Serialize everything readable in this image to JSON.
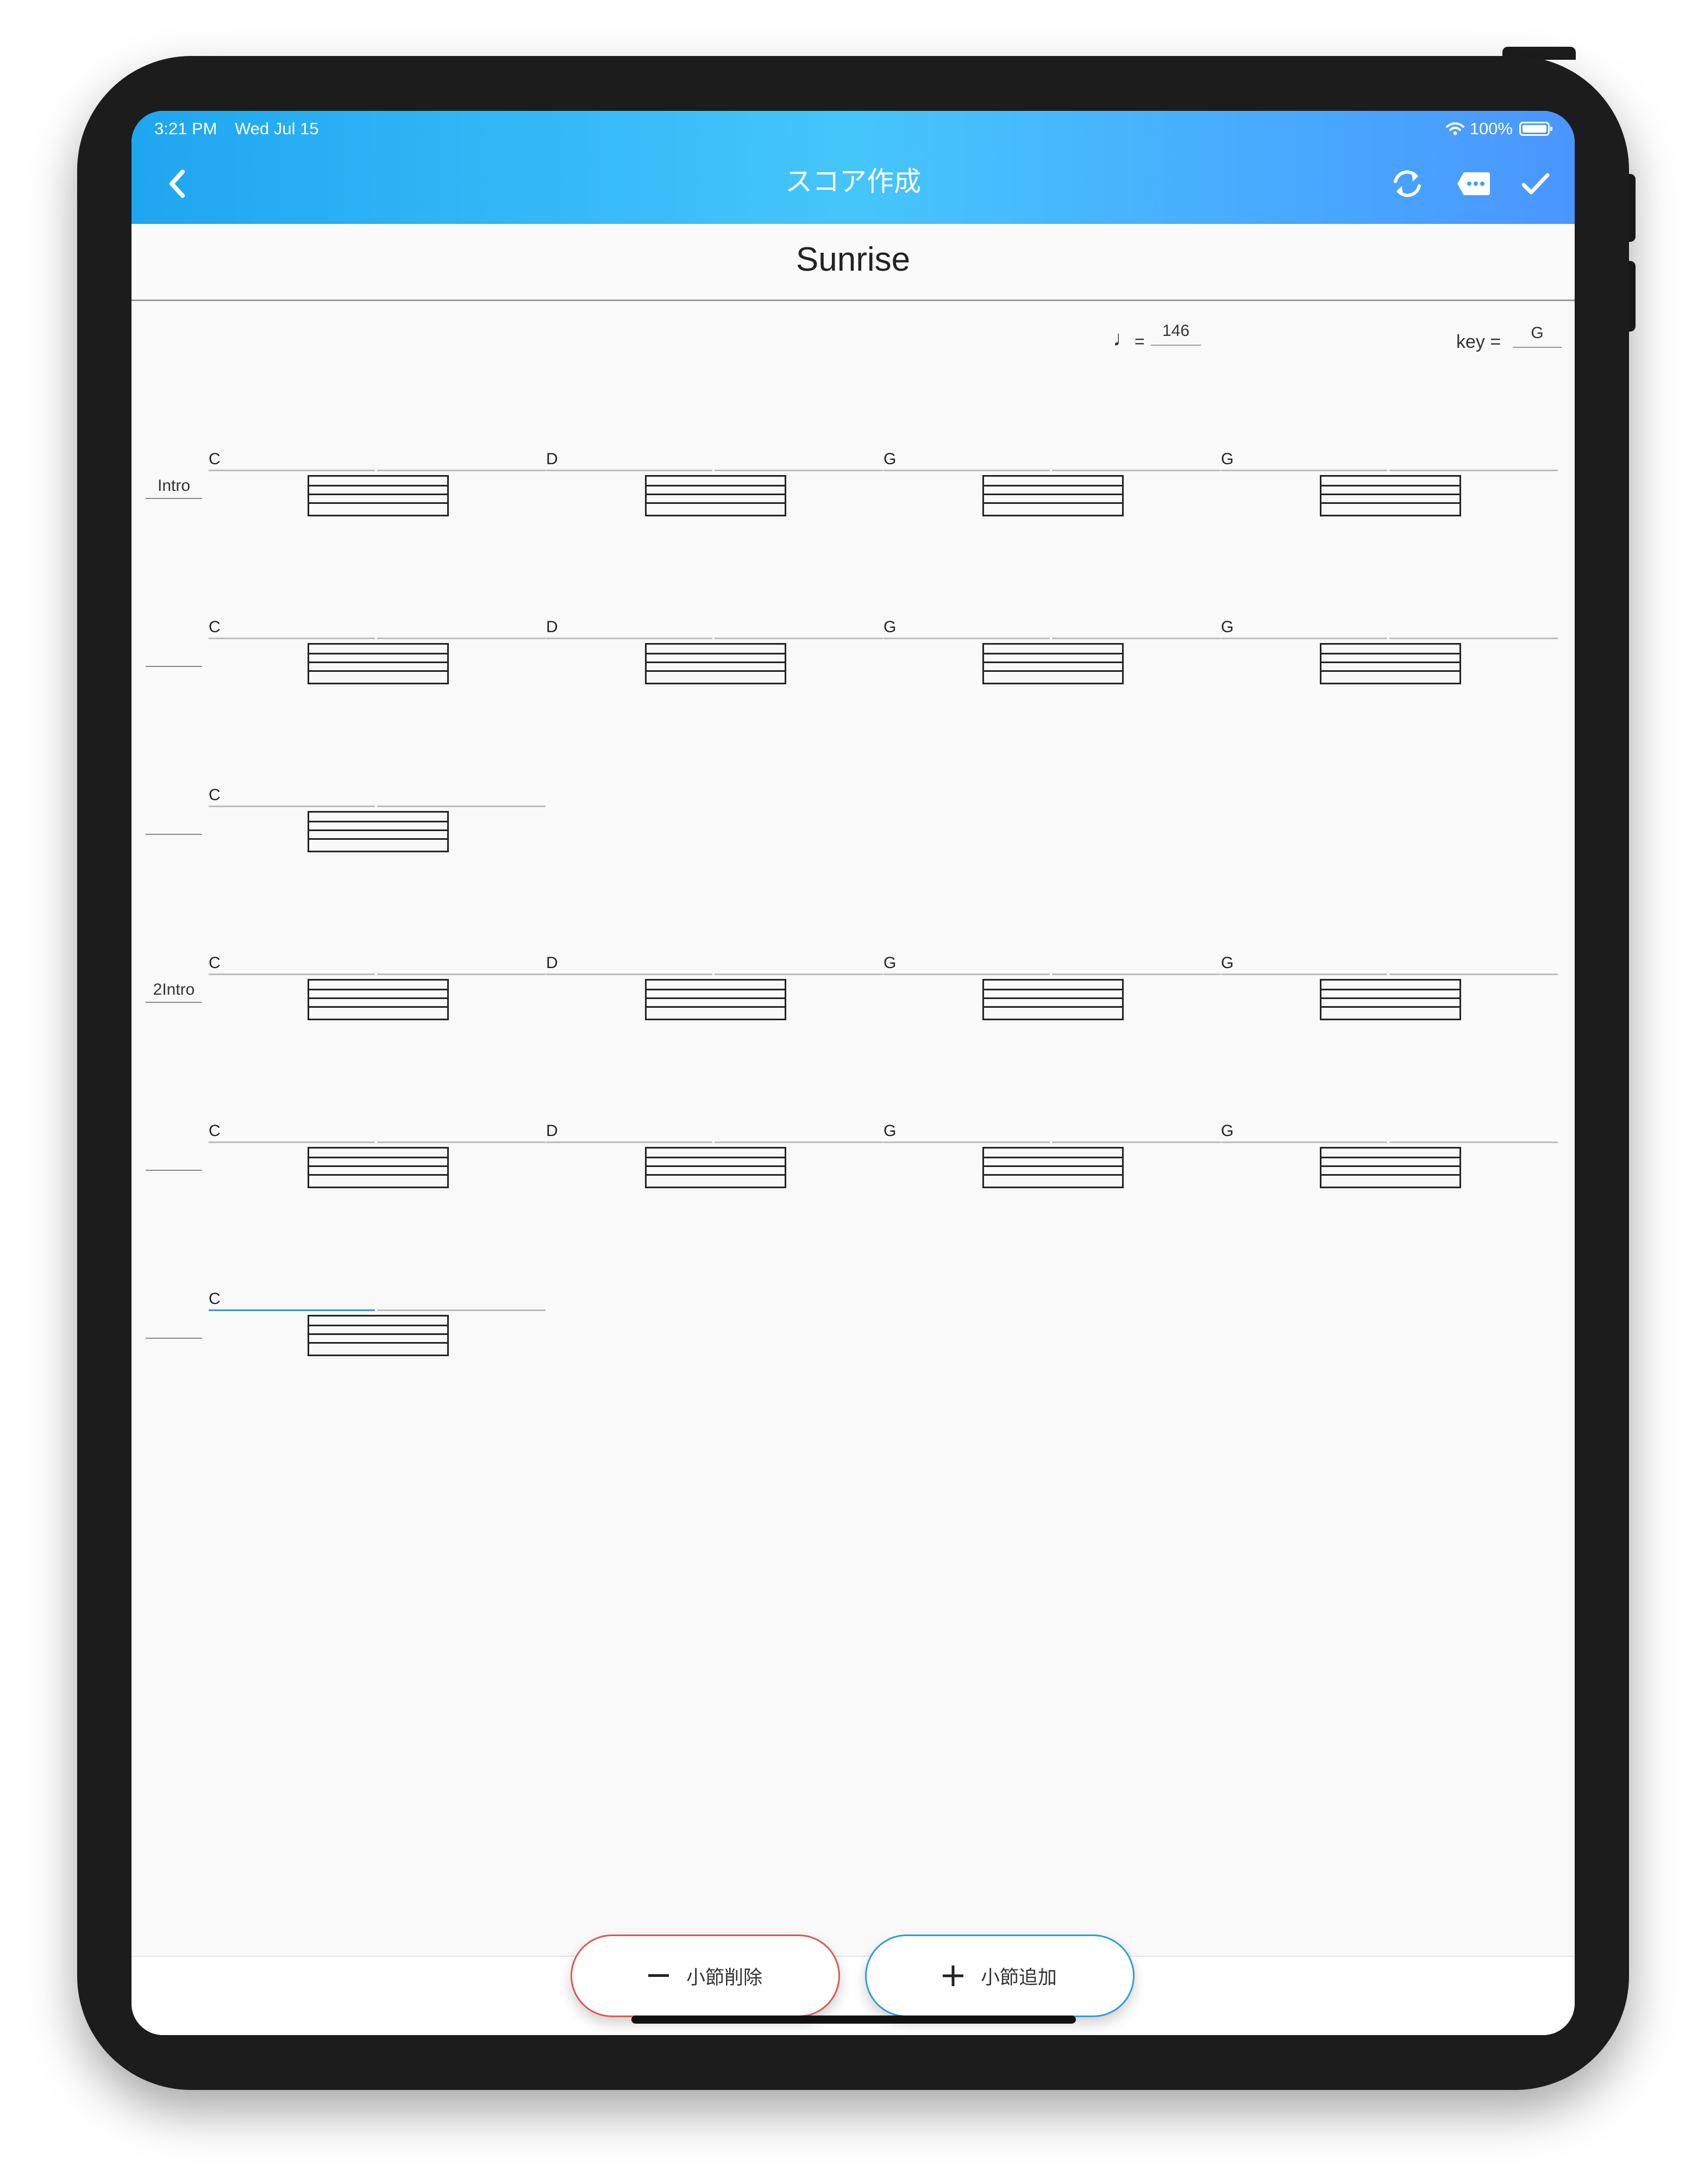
{
  "status_bar": {
    "time": "3:21 PM",
    "date": "Wed Jul 15",
    "battery": "100%"
  },
  "app_bar": {
    "title": "スコア作成"
  },
  "colors": {
    "accent": "#2e9be3",
    "remove": "#e2574c",
    "appbar_start": "#1ea6f0",
    "appbar_end": "#4a96ff"
  },
  "score": {
    "title": "Sunrise",
    "tempo_symbol": "♩",
    "tempo_equals": "=",
    "tempo": "146",
    "key_label": "key =",
    "key": "G"
  },
  "rows": [
    {
      "label": "Intro",
      "chords": [
        "C",
        "D",
        "G",
        "G"
      ]
    },
    {
      "label": "",
      "chords": [
        "C",
        "D",
        "G",
        "G"
      ]
    },
    {
      "label": "",
      "chords": [
        "C"
      ]
    },
    {
      "label": "2Intro",
      "chords": [
        "C",
        "D",
        "G",
        "G"
      ]
    },
    {
      "label": "",
      "chords": [
        "C",
        "D",
        "G",
        "G"
      ]
    },
    {
      "label": "",
      "chords": [
        "C"
      ]
    }
  ],
  "buttons": {
    "remove_measure": "小節削除",
    "add_measure": "小節追加"
  },
  "icons": [
    "back-icon",
    "sync-icon",
    "more-icon",
    "check-icon",
    "wifi-icon",
    "battery-icon",
    "minus-icon",
    "plus-icon"
  ]
}
